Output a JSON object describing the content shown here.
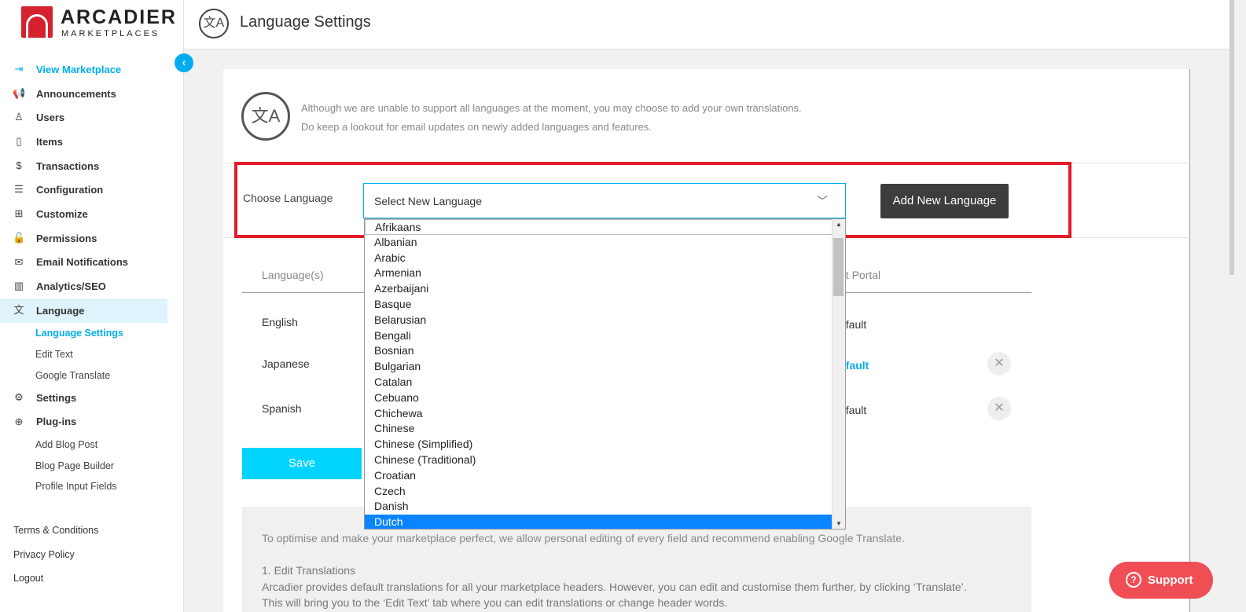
{
  "logo": {
    "word1": "ARCADIER",
    "word2": "MARKETPLACES"
  },
  "sidebar": {
    "items": [
      {
        "label": "View Marketplace",
        "icon": "enter-icon"
      },
      {
        "label": "Announcements",
        "icon": "megaphone-icon"
      },
      {
        "label": "Users",
        "icon": "user-icon"
      },
      {
        "label": "Items",
        "icon": "bag-icon"
      },
      {
        "label": "Transactions",
        "icon": "dollar-icon"
      },
      {
        "label": "Configuration",
        "icon": "sliders-icon"
      },
      {
        "label": "Customize",
        "icon": "grid-icon"
      },
      {
        "label": "Permissions",
        "icon": "lock-icon"
      },
      {
        "label": "Email Notifications",
        "icon": "envelope-icon"
      },
      {
        "label": "Analytics/SEO",
        "icon": "bar-chart-icon"
      },
      {
        "label": "Language",
        "icon": "translate-icon"
      }
    ],
    "language_sub": [
      "Language Settings",
      "Edit Text",
      "Google Translate"
    ],
    "after_items": [
      {
        "label": "Settings",
        "icon": "gear-icon"
      },
      {
        "label": "Plug-ins",
        "icon": "plugin-icon"
      }
    ],
    "plugin_sub": [
      "Add Blog Post",
      "Blog Page Builder",
      "Profile Input Fields"
    ],
    "footer": [
      "Terms & Conditions",
      "Privacy Policy",
      "Logout"
    ]
  },
  "header": {
    "title": "Language Settings"
  },
  "intro": {
    "line1": "Although we are unable to support all languages at the moment, you may choose to add your own translations.",
    "line2": "Do keep a lookout for email updates on newly added languages and features."
  },
  "choose": {
    "label": "Choose Language",
    "select_value": "Select New Language",
    "add_button": "Add New Language"
  },
  "dropdown_options": [
    "Afrikaans",
    "Albanian",
    "Arabic",
    "Armenian",
    "Azerbaijani",
    "Basque",
    "Belarusian",
    "Bengali",
    "Bosnian",
    "Bulgarian",
    "Catalan",
    "Cebuano",
    "Chichewa",
    "Chinese",
    "Chinese (Simplified)",
    "Chinese (Traditional)",
    "Croatian",
    "Czech",
    "Danish",
    "Dutch"
  ],
  "table": {
    "col_language": "Language(s)",
    "col_portal": "nt Portal",
    "rows": [
      {
        "name": "English",
        "portal": "efault"
      },
      {
        "name": "Japanese",
        "portal": "efault"
      },
      {
        "name": "Spanish",
        "portal": "efault"
      }
    ]
  },
  "save_label": "Save",
  "info": {
    "p1": "To optimise and make your marketplace perfect, we allow personal editing of every field and recommend enabling Google Translate.",
    "heading": "1. Edit Translations",
    "p2": "Arcadier provides default translations for all your marketplace headers. However, you can edit and customise them further, by clicking ‘Translate’.",
    "p3": "This will bring you to the ‘Edit Text’ tab where you can edit translations or change header words."
  },
  "support_label": "Support",
  "colors": {
    "accent": "#00aeef",
    "highlight": "#e21b2a",
    "dark_button": "#3d3d3d",
    "support": "#ef4e55",
    "selected_option": "#0a84ff"
  }
}
